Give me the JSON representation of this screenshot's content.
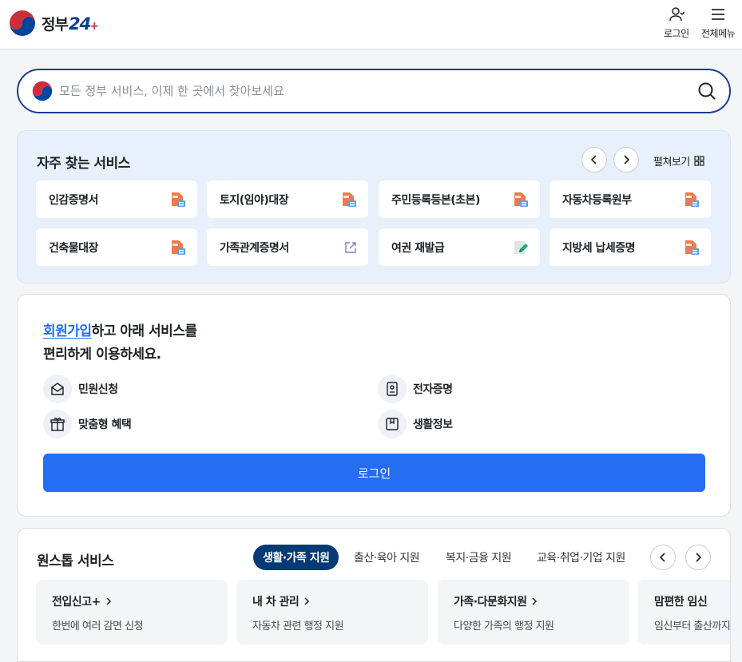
{
  "header": {
    "logo_text": "정부",
    "logo_num": "24",
    "logo_plus": "+",
    "login_label": "로그인",
    "menu_label": "전체메뉴"
  },
  "search": {
    "placeholder": "모든 정부 서비스, 이제 한 곳에서 찾아보세요"
  },
  "frequent": {
    "title": "자주 찾는 서비스",
    "expand_label": "펼쳐보기",
    "items": [
      {
        "label": "인감증명서",
        "icon": "pdf-doc-icon"
      },
      {
        "label": "토지(임야)대장",
        "icon": "pdf-doc-icon"
      },
      {
        "label": "주민등록등본(초본)",
        "icon": "pdf-doc-icon"
      },
      {
        "label": "자동차등록원부",
        "icon": "pdf-doc-icon"
      },
      {
        "label": "건축물대장",
        "icon": "pdf-doc-icon"
      },
      {
        "label": "가족관계증명서",
        "icon": "external-link-icon"
      },
      {
        "label": "여권 재발급",
        "icon": "edit-doc-icon"
      },
      {
        "label": "지방세 납세증명",
        "icon": "pdf-doc-icon"
      }
    ]
  },
  "login_panel": {
    "signup_link": "회원가입",
    "msg_rest": "하고 아래 서비스를",
    "msg_line2": "편리하게 이용하세요.",
    "features": [
      {
        "label": "민원신청",
        "icon": "mail-icon"
      },
      {
        "label": "전자증명",
        "icon": "certificate-icon"
      },
      {
        "label": "맞춤형 혜택",
        "icon": "gift-icon"
      },
      {
        "label": "생활정보",
        "icon": "bookmark-icon"
      }
    ],
    "login_button": "로그인"
  },
  "onestop": {
    "title": "원스톱 서비스",
    "tabs": [
      "생활·가족 지원",
      "출산·육아 지원",
      "복지·금융 지원",
      "교육·취업·기업 지원"
    ],
    "active_tab": 0,
    "cards": [
      {
        "title": "전입신고+",
        "desc": "한번에 여러 감면 신청"
      },
      {
        "title": "내 차 관리",
        "desc": "자동차 관련 행정 지원"
      },
      {
        "title": "가족·다문화지원",
        "desc": "다양한 가족의 행정 지원"
      },
      {
        "title": "맘편한 임신",
        "desc": "임신부터 출산까지"
      }
    ]
  },
  "colors": {
    "primary": "#256ef4",
    "navy": "#063a74",
    "search_border": "#1d3d8f",
    "freq_bg": "#e7f0fb",
    "link": "#256ef4"
  }
}
